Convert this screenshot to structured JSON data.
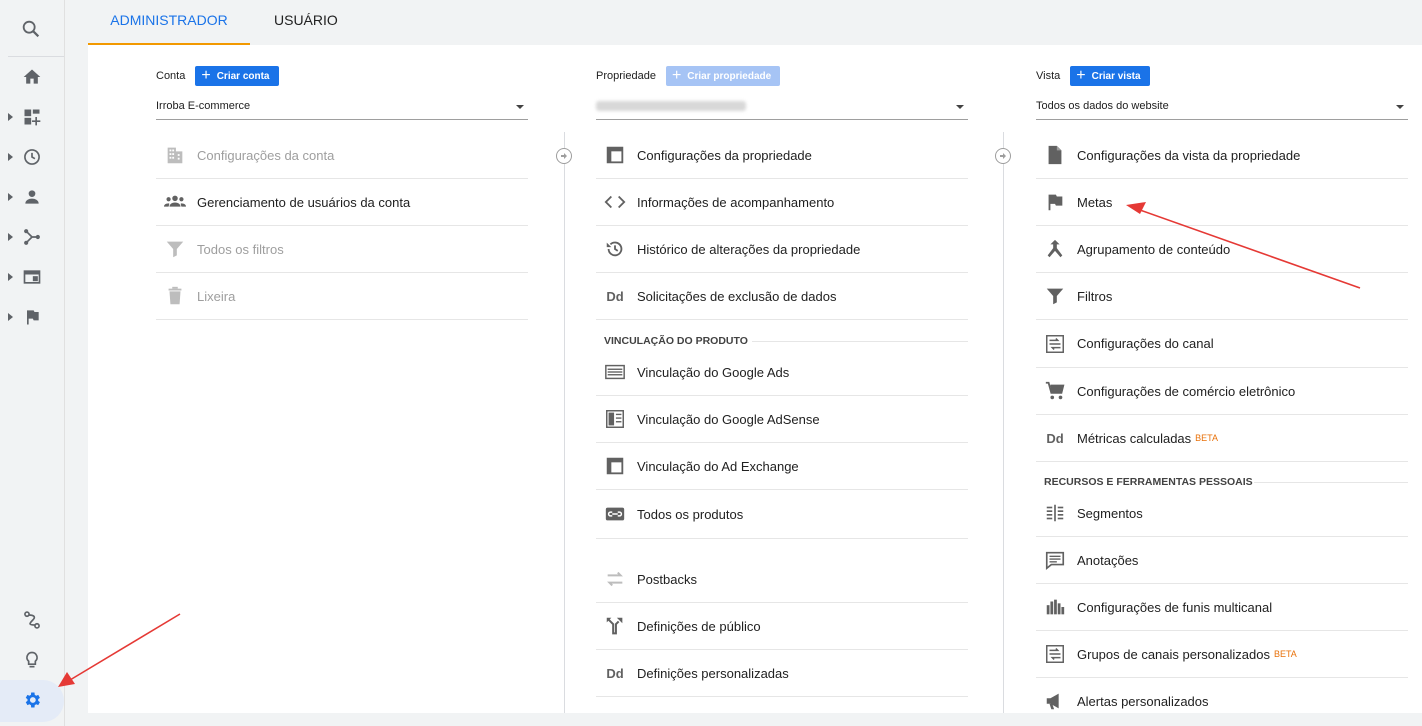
{
  "tabs": {
    "admin": "ADMINISTRADOR",
    "user": "USUÁRIO"
  },
  "account": {
    "label": "Conta",
    "create_button": "Criar conta",
    "selected": "Irroba E-commerce",
    "items": [
      {
        "label": "Configurações da conta",
        "icon": "building-icon",
        "disabled": true
      },
      {
        "label": "Gerenciamento de usuários da conta",
        "icon": "users-icon",
        "disabled": false
      },
      {
        "label": "Todos os filtros",
        "icon": "filter-icon",
        "disabled": true
      },
      {
        "label": "Lixeira",
        "icon": "trash-icon",
        "disabled": true
      }
    ]
  },
  "property": {
    "label": "Propriedade",
    "create_button": "Criar propriedade",
    "items": [
      {
        "label": "Configurações da propriedade",
        "icon": "property-settings-icon"
      },
      {
        "label": "Informações de acompanhamento",
        "icon": "code-icon"
      },
      {
        "label": "Histórico de alterações da propriedade",
        "icon": "history-icon"
      },
      {
        "label": "Solicitações de exclusão de dados",
        "icon": "dd-icon"
      }
    ],
    "linking_section": "VINCULAÇÃO DO PRODUTO",
    "linking_items": [
      {
        "label": "Vinculação do Google Ads",
        "icon": "google-ads-icon"
      },
      {
        "label": "Vinculação do Google AdSense",
        "icon": "adsense-icon"
      },
      {
        "label": "Vinculação do Ad Exchange",
        "icon": "ad-exchange-icon"
      },
      {
        "label": "Todos os produtos",
        "icon": "link-icon"
      }
    ],
    "extra_items": [
      {
        "label": "Postbacks",
        "icon": "postbacks-icon"
      },
      {
        "label": "Definições de público",
        "icon": "audience-icon"
      },
      {
        "label": "Definições personalizadas",
        "icon": "dd-icon"
      }
    ]
  },
  "view": {
    "label": "Vista",
    "create_button": "Criar vista",
    "selected": "Todos os dados do website",
    "items": [
      {
        "label": "Configurações da vista da propriedade",
        "icon": "document-icon"
      },
      {
        "label": "Metas",
        "icon": "flag-icon"
      },
      {
        "label": "Agrupamento de conteúdo",
        "icon": "grouping-icon"
      },
      {
        "label": "Filtros",
        "icon": "filter-icon"
      },
      {
        "label": "Configurações do canal",
        "icon": "channel-icon"
      },
      {
        "label": "Configurações de comércio eletrônico",
        "icon": "cart-icon"
      },
      {
        "label": "Métricas calculadas",
        "icon": "dd-icon",
        "badge": "BETA"
      }
    ],
    "personal_section": "RECURSOS E FERRAMENTAS PESSOAIS",
    "personal_items": [
      {
        "label": "Segmentos",
        "icon": "segments-icon"
      },
      {
        "label": "Anotações",
        "icon": "annotation-icon"
      },
      {
        "label": "Configurações de funis multicanal",
        "icon": "funnel-chart-icon"
      },
      {
        "label": "Grupos de canais personalizados",
        "icon": "channel-icon",
        "badge": "BETA"
      },
      {
        "label": "Alertas personalizados",
        "icon": "megaphone-icon"
      }
    ]
  },
  "colors": {
    "accent": "#1a73e8",
    "tab_underline": "#f29900",
    "arrow": "#e53935",
    "beta": "#e8710a"
  }
}
